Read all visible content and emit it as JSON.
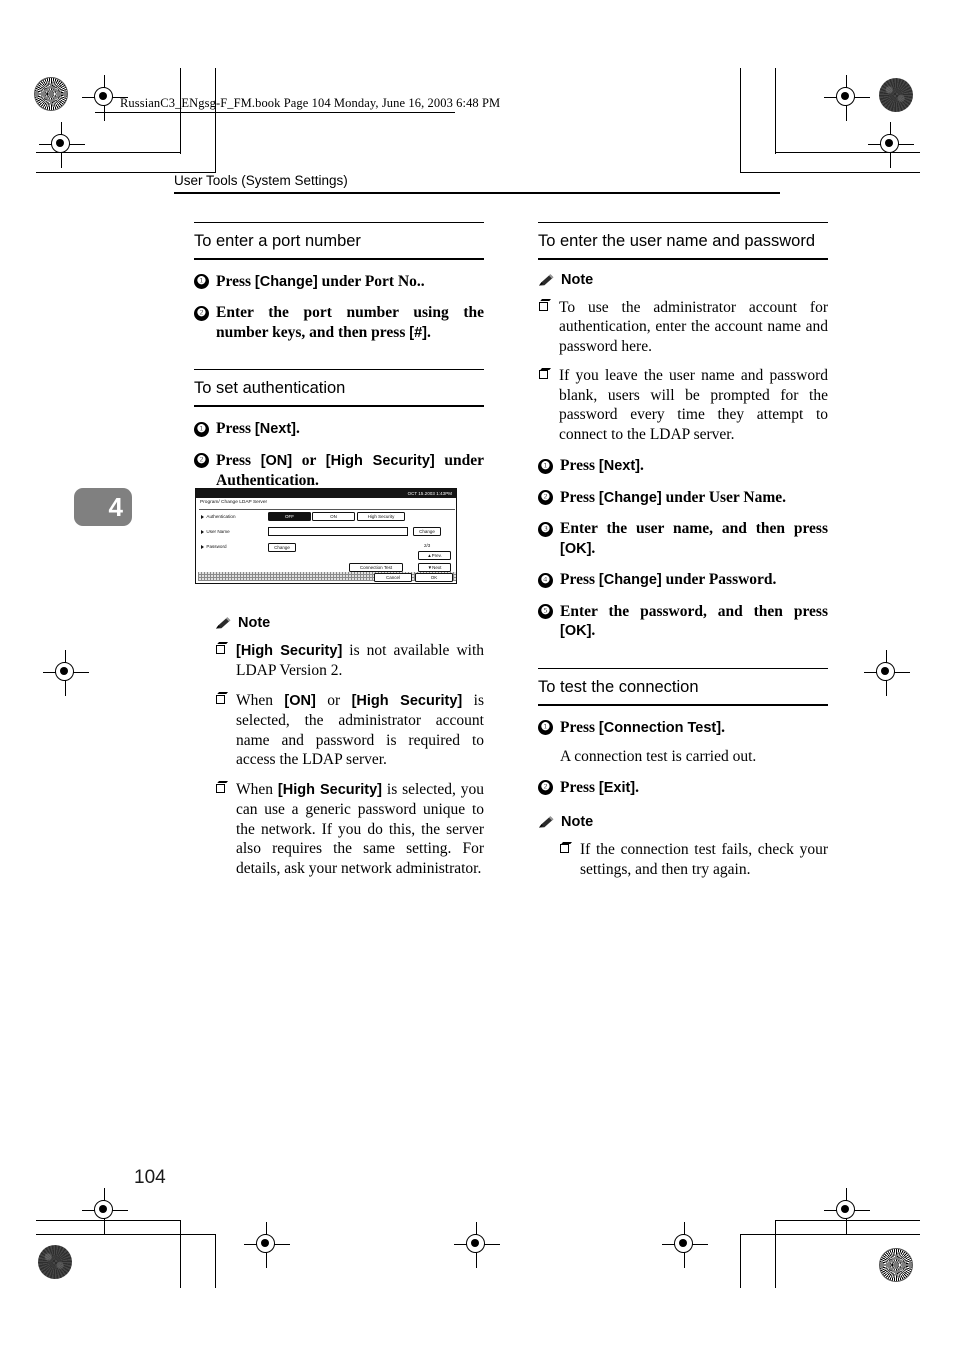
{
  "imprint": {
    "text": "RussianC3_ENgsg-F_FM.book  Page 104  Monday, June 16, 2003  6:48 PM"
  },
  "running_head": "User Tools (System Settings)",
  "chapter_tab": "4",
  "folio": "104",
  "left_column": {
    "section_port": {
      "title": "To enter a port number",
      "steps": [
        {
          "num": "❶",
          "text": "Press [Change] under Port No.."
        },
        {
          "num": "❷",
          "text": "Enter the port number using the number keys, and then press [#]."
        }
      ]
    },
    "section_auth": {
      "title": "To set authentication",
      "steps": [
        {
          "num": "❶",
          "text": "Press [Next]."
        },
        {
          "num": "❷",
          "text": "Press [ON] or [High Security] under Authentication."
        }
      ],
      "note_label": "Note",
      "notes": [
        "[High Security] is not available with LDAP Version 2.",
        "When [ON] or [High Security] is selected, the administrator account name and password is required to access the LDAP server.",
        "When [High Security] is selected, you can use a generic password unique to the network. If you do this, the server also requires the same setting. For details, ask your network administrator."
      ]
    }
  },
  "right_column": {
    "section_username": {
      "title": "To enter the user name and password",
      "note_label": "Note",
      "notes": [
        "To use the administrator account for authentication, enter the account name and password here.",
        "If you leave the user name and password blank, users will be prompted for the password every time they attempt to connect to the LDAP server."
      ],
      "steps": [
        {
          "num": "❶",
          "text": "Press [Next]."
        },
        {
          "num": "❷",
          "text": "Press [Change] under User Name."
        },
        {
          "num": "❸",
          "text": "Enter the user name, and then press [OK]."
        },
        {
          "num": "❹",
          "text": "Press [Change] under Password."
        },
        {
          "num": "❺",
          "text": "Enter the password, and then press [OK]."
        }
      ]
    },
    "section_connection": {
      "title": "To test the connection",
      "steps": [
        {
          "num": "❶",
          "text": "Press [Connection Test].",
          "sub": "A connection test is carried out."
        },
        {
          "num": "❷",
          "text": "Press [Exit]."
        }
      ],
      "note_label": "Note",
      "notes": [
        "If the connection test fails, check your settings, and then try again."
      ]
    }
  },
  "figure": {
    "status_bar": "OCT  15.2003  1:43PM",
    "panel_title": "Program/ Change LDAP Server",
    "rows": [
      {
        "label": "Authentication"
      },
      {
        "label": "User Name"
      },
      {
        "label": "Password"
      }
    ],
    "auth_options": [
      {
        "label": "OFF",
        "selected": true
      },
      {
        "label": "ON",
        "selected": false
      },
      {
        "label": "High Security",
        "selected": false
      }
    ],
    "username_change": "Change",
    "password_change": "Change",
    "page_indicator": "2/3",
    "prev_button": "▲Prev.",
    "next_button": "▼Next",
    "connection_test_button": "Connection Test",
    "cancel_button": "Cancel",
    "ok_button": "OK"
  }
}
